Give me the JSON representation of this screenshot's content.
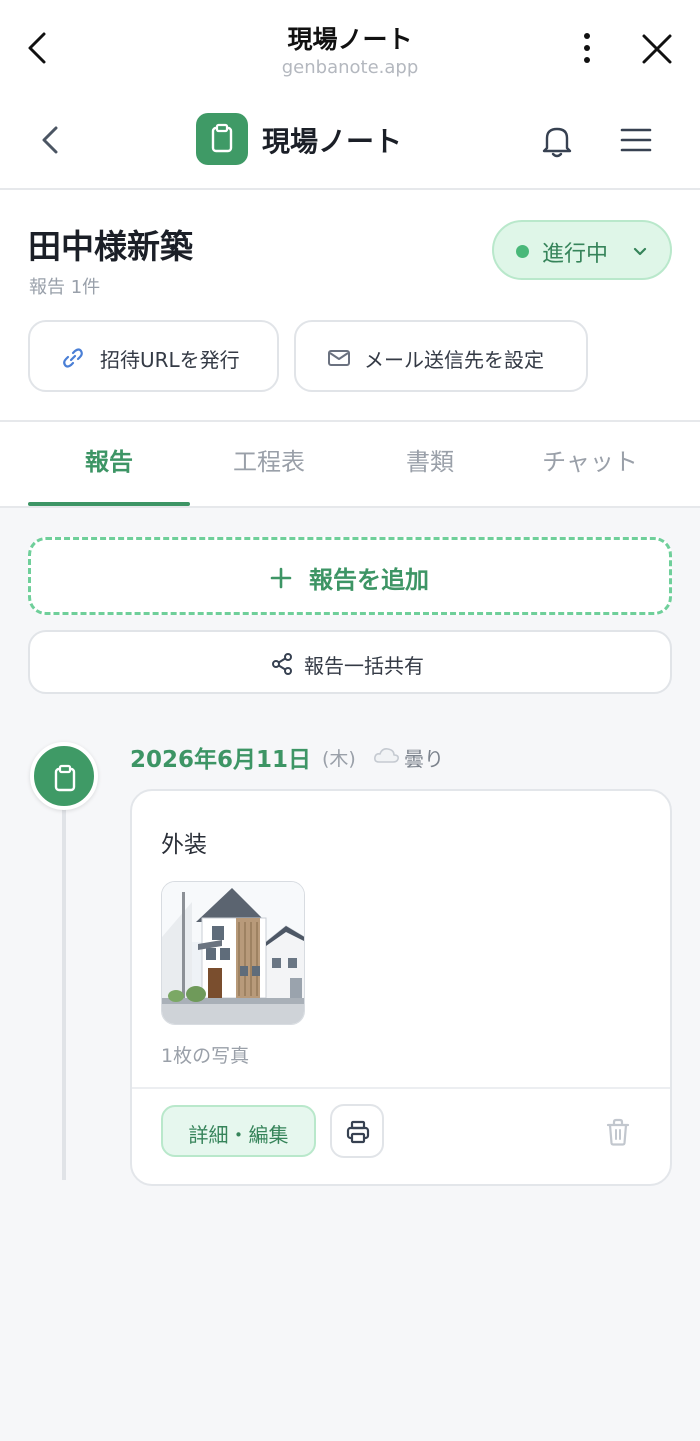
{
  "browser": {
    "title": "現場ノート",
    "domain": "genbanote.app",
    "icons": [
      "chevron-left-icon",
      "more-vertical-icon",
      "close-icon"
    ]
  },
  "app": {
    "brand": "現場ノート",
    "logo_icon": "clipboard-icon",
    "icons": [
      "chevron-left-icon",
      "bell-icon",
      "hamburger-menu-icon"
    ]
  },
  "project": {
    "title": "田中様新築",
    "subtitle": "報告 1件",
    "status": {
      "label": "進行中",
      "color": "#49b879"
    },
    "actions": {
      "invite_label": "招待URLを発行",
      "mail_label": "メール送信先を設定"
    }
  },
  "tabs": [
    {
      "label": "報告",
      "active": true
    },
    {
      "label": "工程表",
      "active": false
    },
    {
      "label": "書類",
      "active": false
    },
    {
      "label": "チャット",
      "active": false
    }
  ],
  "report_actions": {
    "add_label": "報告を追加",
    "share_all_label": "報告一括共有"
  },
  "entries": [
    {
      "date": "2026年6月11日",
      "weekday": "(木)",
      "weather": "曇り",
      "title": "外装",
      "photo_count": "1枚の写真",
      "edit_label": "詳細・編集"
    }
  ],
  "colors": {
    "accent": "#3d9565",
    "accent_light": "#e6f7ee",
    "background": "#f6f7f9"
  }
}
